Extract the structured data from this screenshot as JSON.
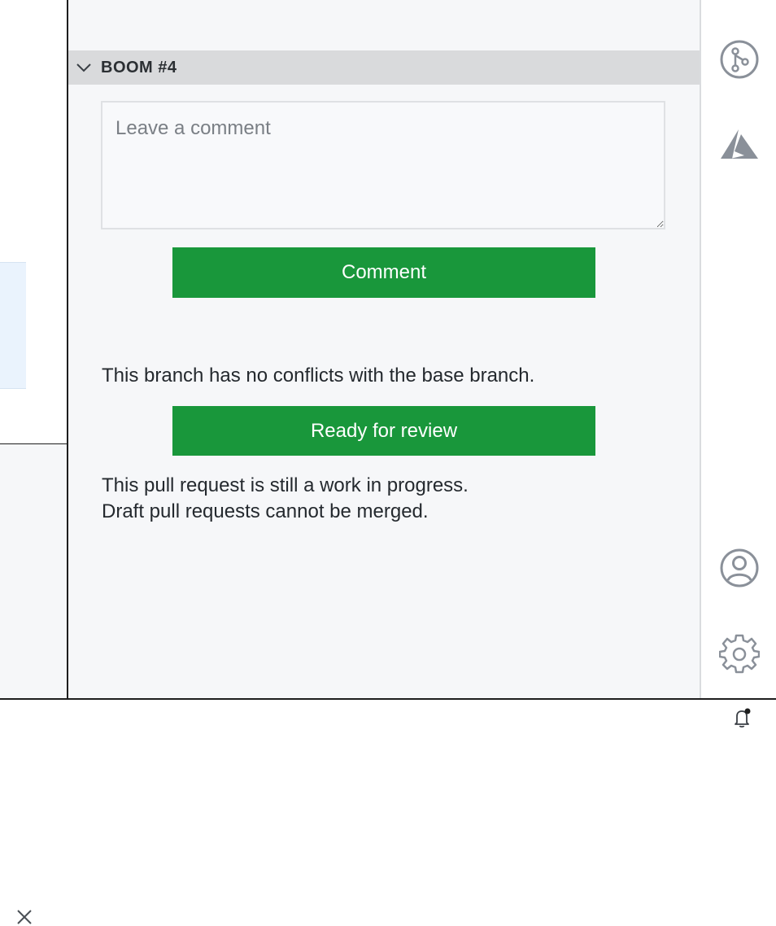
{
  "section": {
    "title": "BOOM #4"
  },
  "comment": {
    "placeholder": "Leave a comment",
    "value": "",
    "button_label": "Comment"
  },
  "merge": {
    "conflict_message": "This branch has no conflicts with the base branch.",
    "ready_button_label": "Ready for review",
    "draft_message_line1": "This pull request is still a work in progress.",
    "draft_message_line2": "Draft pull requests cannot be merged."
  },
  "activity_bar": {
    "icons": [
      "pull-request-icon",
      "azure-icon",
      "account-icon",
      "settings-icon"
    ]
  },
  "status_bar": {
    "icons": [
      "notification-bell-icon"
    ]
  },
  "colors": {
    "primary_button": "#19973b",
    "panel_background": "#f6f7f9",
    "section_header_background": "#d9dadc",
    "icon_gray": "#8a9099"
  }
}
